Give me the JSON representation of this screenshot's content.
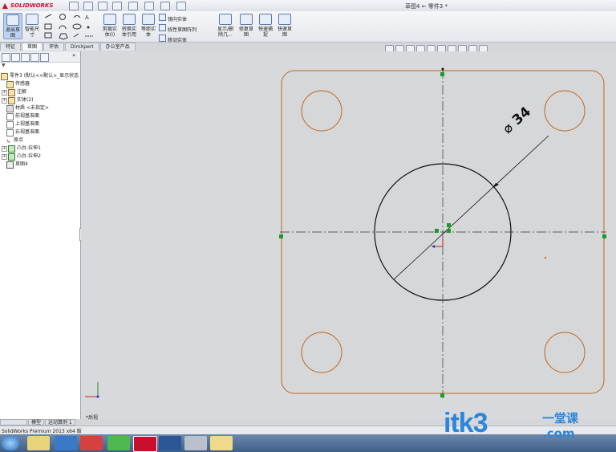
{
  "app": {
    "brand": "SOLIDWORKS",
    "doc_title": "草图4 ← 零件3 *"
  },
  "ribbon": {
    "sketch_label": "退出草图",
    "smart_dim": "智能尺寸",
    "trim": "剪裁实体(I)",
    "convert": "转换实体引用",
    "offset": "等距实体",
    "mirror": "镜向实体",
    "linear_pattern": "线性草图阵列",
    "move": "移动实体",
    "display_relations": "显示/删除几...",
    "repair": "修复草图",
    "quick_snap": "快速捕捉",
    "quick_sketch": "快速草图"
  },
  "tabs": [
    "特征",
    "草图",
    "评估",
    "DimXpert",
    "办公室产品"
  ],
  "tree": {
    "root": "零件3 (默认<<默认>_显示状态",
    "items": [
      "传感器",
      "注解",
      "实体(2)",
      "材质 <未指定>",
      "前视基准面",
      "上视基准面",
      "右视基准面",
      "原点",
      "凸台-拉伸1",
      "凸台-拉伸2",
      "草图4"
    ]
  },
  "canvas": {
    "dimension_label": "34",
    "dimension_symbol": "⌀",
    "view_name": "*后视"
  },
  "model_tabs": [
    "模型",
    "运动算例 1"
  ],
  "status": {
    "text": "SolidWorks Premium 2013 x64 版"
  },
  "watermark": {
    "main": "itk3",
    "sub": "一堂课",
    "dotcom": ".com"
  },
  "colors": {
    "sketch_edge": "#c0661a",
    "selection_green": "#1a9c2a",
    "accent": "#2b86d9"
  }
}
